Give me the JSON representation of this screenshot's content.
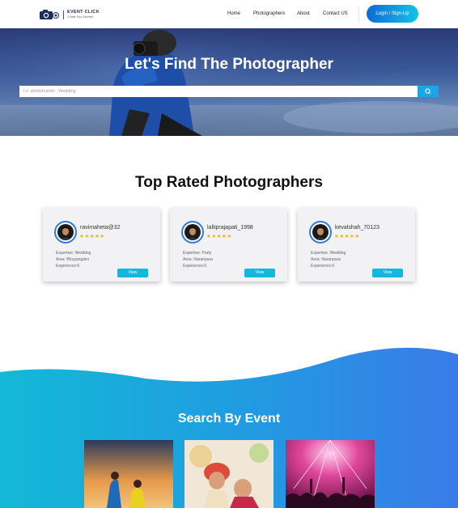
{
  "nav": {
    "logo_title": "EVENT CLICK",
    "logo_tagline": "Create Your Moment",
    "links": [
      "Home",
      "Photographers",
      "About",
      "Contact US"
    ],
    "login_label": "Login / Sign-Up"
  },
  "hero": {
    "title": "Let's Find The Photographer",
    "search_placeholder": "I.e. photohunter , Wedding"
  },
  "top_rated": {
    "title": "Top Rated Photographers",
    "rating_stars": "★★★★★",
    "view_label": "View",
    "cards": [
      {
        "name": "ravimaheta@32",
        "expertise": "Expertise: Wedding",
        "area": "Area: Bhuyangdev",
        "experience": "Experience:6"
      },
      {
        "name": "lalitprajapati_1998",
        "expertise": "Expertise: Party",
        "area": "Area: Naranpura",
        "experience": "Experience:6"
      },
      {
        "name": "kevalshah_70123",
        "expertise": "Expertise: Wedding",
        "area": "Area: Naranpura",
        "experience": "Experience:6"
      }
    ]
  },
  "events": {
    "title": "Search By Event"
  },
  "colors": {
    "accent": "#13b9dd",
    "login_gradient_start": "#0d6bd6",
    "login_gradient_end": "#14c3e6",
    "star": "#f5b400",
    "wave_start": "#14b8d6",
    "wave_end": "#3a7be8"
  }
}
